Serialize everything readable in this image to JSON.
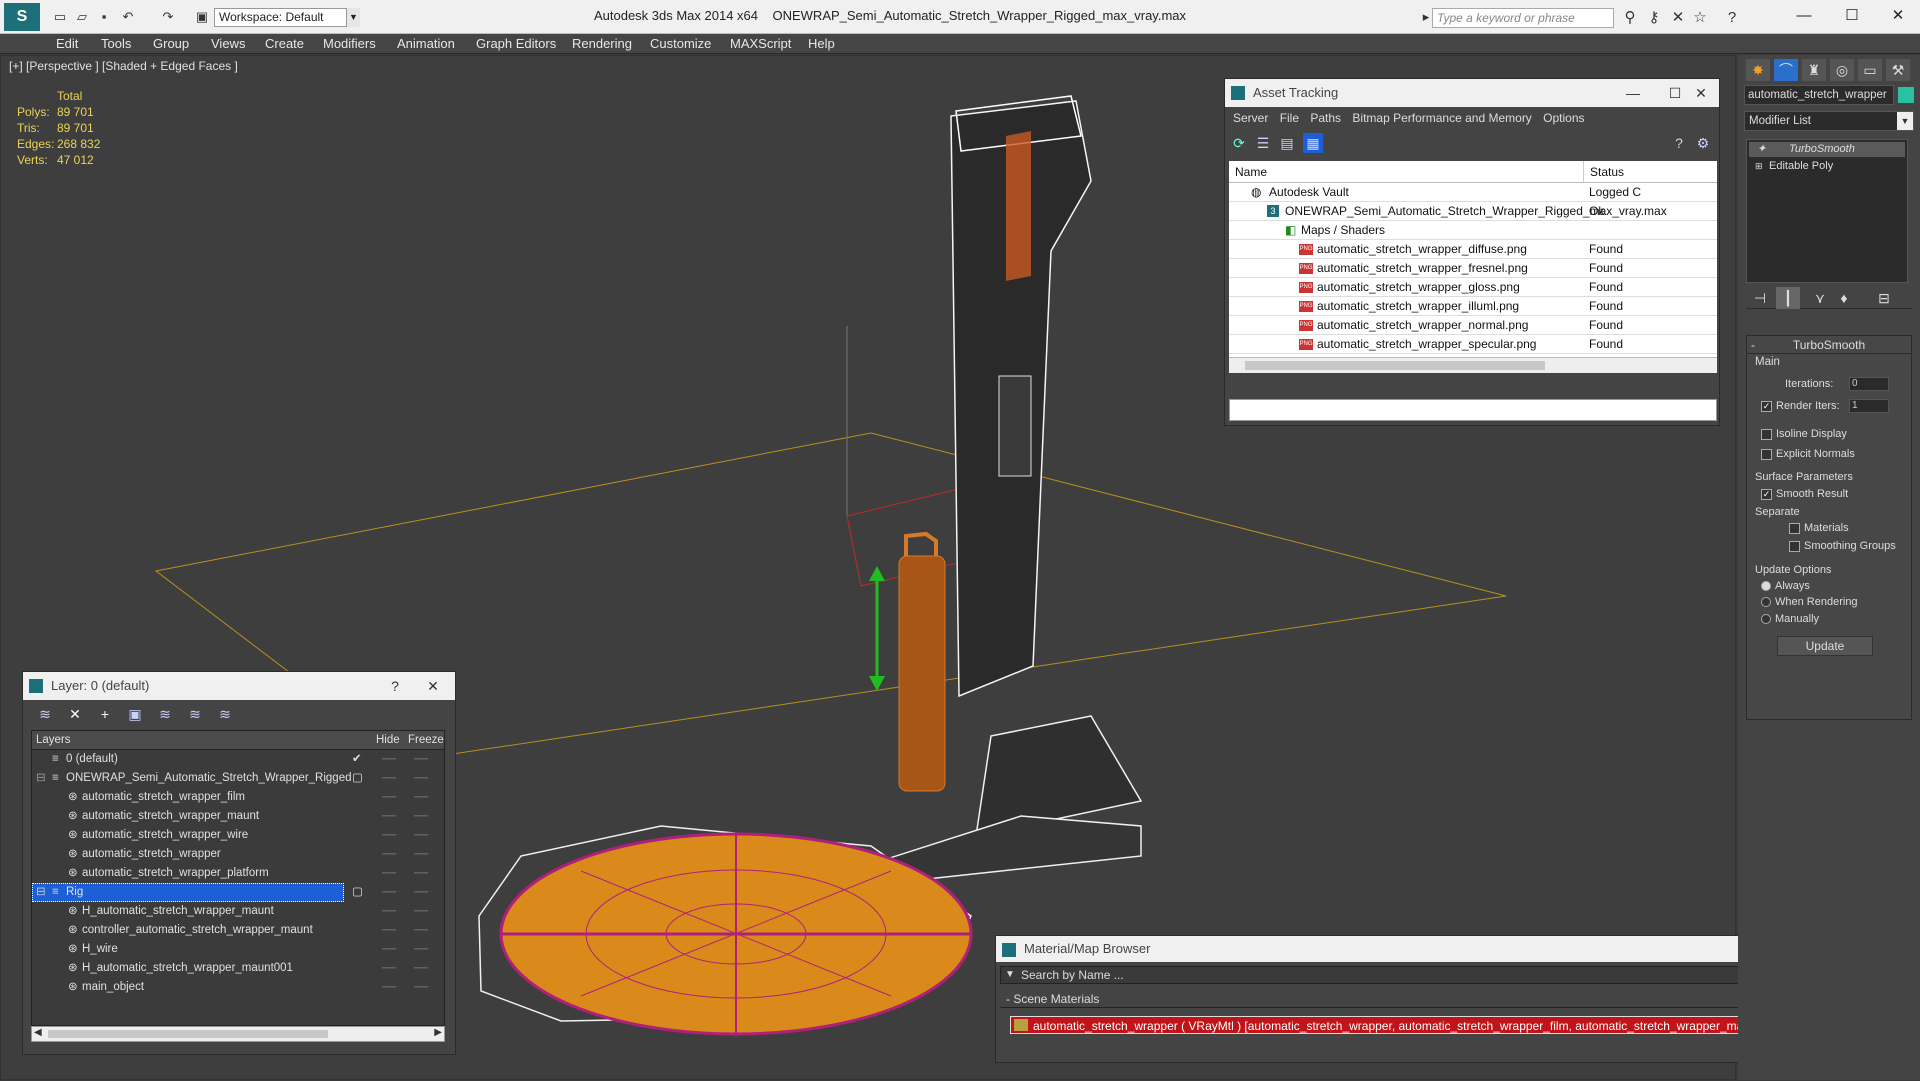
{
  "app": {
    "logo": "S",
    "workspace": "Workspace: Default",
    "title": "Autodesk 3ds Max  2014 x64",
    "file": "ONEWRAP_Semi_Automatic_Stretch_Wrapper_Rigged_max_vray.max",
    "search_placeholder": "Type a keyword or phrase"
  },
  "menus": [
    "Edit",
    "Tools",
    "Group",
    "Views",
    "Create",
    "Modifiers",
    "Animation",
    "Graph Editors",
    "Rendering",
    "Customize",
    "MAXScript",
    "Help"
  ],
  "viewport": {
    "label": "[+] [Perspective ] [Shaded + Edged Faces ]",
    "stats": {
      "header": "Total",
      "rows": [
        {
          "k": "Polys:",
          "v": "89 701"
        },
        {
          "k": "Tris:",
          "v": "89 701"
        },
        {
          "k": "Edges:",
          "v": "268 832"
        },
        {
          "k": "Verts:",
          "v": "47 012"
        }
      ]
    }
  },
  "asset_tracking": {
    "title": "Asset Tracking",
    "menu": [
      "Server",
      "File",
      "Paths",
      "Bitmap Performance and Memory",
      "Options"
    ],
    "columns": [
      "Name",
      "Status"
    ],
    "rows": [
      {
        "name": "Autodesk Vault",
        "status": "Logged C"
      },
      {
        "name": "ONEWRAP_Semi_Automatic_Stretch_Wrapper_Rigged_max_vray.max",
        "status": "Ok"
      },
      {
        "name": "Maps / Shaders",
        "status": ""
      },
      {
        "name": "automatic_stretch_wrapper_diffuse.png",
        "status": "Found"
      },
      {
        "name": "automatic_stretch_wrapper_fresnel.png",
        "status": "Found"
      },
      {
        "name": "automatic_stretch_wrapper_gloss.png",
        "status": "Found"
      },
      {
        "name": "automatic_stretch_wrapper_illuml.png",
        "status": "Found"
      },
      {
        "name": "automatic_stretch_wrapper_normal.png",
        "status": "Found"
      },
      {
        "name": "automatic_stretch_wrapper_specular.png",
        "status": "Found"
      }
    ]
  },
  "layer_panel": {
    "title": "Layer: 0 (default)",
    "help": "?",
    "columns": [
      "Layers",
      "Hide",
      "Freeze"
    ],
    "rows": [
      {
        "name": "0 (default)",
        "selected": false
      },
      {
        "name": "ONEWRAP_Semi_Automatic_Stretch_Wrapper_Rigged",
        "selected": false
      },
      {
        "name": "automatic_stretch_wrapper_film",
        "selected": false
      },
      {
        "name": "automatic_stretch_wrapper_maunt",
        "selected": false
      },
      {
        "name": "automatic_stretch_wrapper_wire",
        "selected": false
      },
      {
        "name": "automatic_stretch_wrapper",
        "selected": false
      },
      {
        "name": "automatic_stretch_wrapper_platform",
        "selected": false
      },
      {
        "name": "Rig",
        "selected": true
      },
      {
        "name": "H_automatic_stretch_wrapper_maunt",
        "selected": false
      },
      {
        "name": "controller_automatic_stretch_wrapper_maunt",
        "selected": false
      },
      {
        "name": "H_wire",
        "selected": false
      },
      {
        "name": "H_automatic_stretch_wrapper_maunt001",
        "selected": false
      },
      {
        "name": "main_object",
        "selected": false
      }
    ]
  },
  "material_browser": {
    "title": "Material/Map Browser",
    "search_placeholder": "Search by Name ...",
    "section": "- Scene Materials",
    "item": "automatic_stretch_wrapper  ( VRayMtl ) [automatic_stretch_wrapper, automatic_stretch_wrapper_film, automatic_stretch_wrapper_maunt, automatic_stretch_wra..."
  },
  "command_panel": {
    "object_name": "automatic_stretch_wrapper",
    "modifier_list": "Modifier List",
    "stack": [
      "TurboSmooth",
      "Editable Poly"
    ],
    "rollout_title": "TurboSmooth",
    "main_label": "Main",
    "iterations_label": "Iterations:",
    "iterations_value": "0",
    "render_iters_label": "Render Iters:",
    "render_iters_value": "1",
    "isoline": "Isoline Display",
    "explicit": "Explicit Normals",
    "surface_params": "Surface Parameters",
    "smooth_result": "Smooth Result",
    "separate": "Separate",
    "materials": "Materials",
    "smoothing_groups": "Smoothing Groups",
    "update_options": "Update Options",
    "always": "Always",
    "when_rendering": "When Rendering",
    "manually": "Manually",
    "update_button": "Update"
  },
  "colors": {
    "accent": "#1d6f7a",
    "selection": "#1c5fd6",
    "object_orange": "#d98a1a",
    "object_magenta": "#b0207a"
  }
}
